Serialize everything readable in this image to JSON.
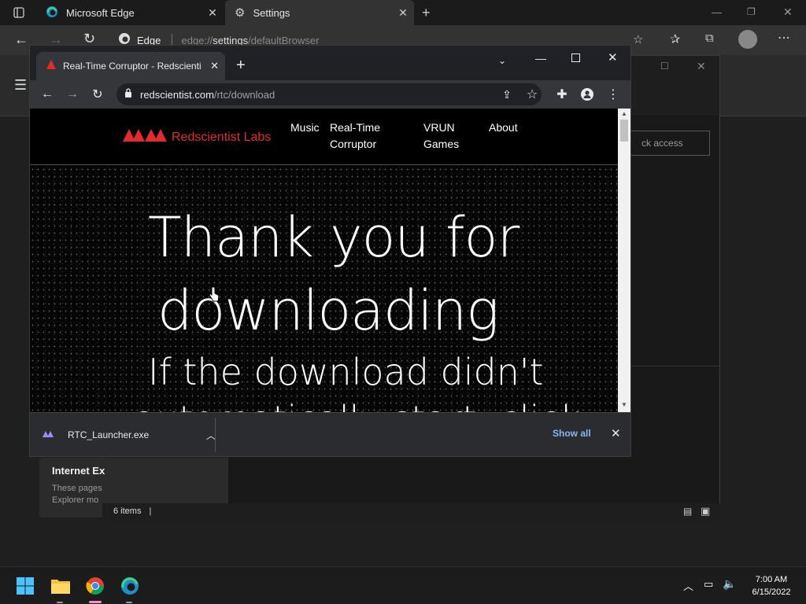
{
  "edge": {
    "tabs": [
      {
        "label": "Microsoft Edge"
      },
      {
        "label": "Settings"
      }
    ],
    "address": {
      "brand": "Edge",
      "url_prefix": "edge://",
      "url_strong": "settings",
      "url_rest": "/defaultBrowser"
    },
    "quick_access_placeholder": "ck access"
  },
  "explorer": {
    "ie_card_title": "Internet Ex",
    "ie_card_desc_line1": "These pages",
    "ie_card_desc_line2": "Explorer mo",
    "status_items": "6 items"
  },
  "chrome": {
    "tab_title": "Real-Time Corruptor - Redscienti",
    "url_host": "redscientist.com",
    "url_path": "/rtc/download",
    "site": {
      "logo_text": "Redscientist Labs",
      "nav": [
        {
          "line1": "Music",
          "line2": ""
        },
        {
          "line1": "Real-Time",
          "line2": "Corruptor"
        },
        {
          "line1": "VRUN",
          "line2": "Games"
        },
        {
          "line1": "About",
          "line2": ""
        }
      ],
      "hero_line1": "Thank you for",
      "hero_line2": "downloading",
      "hero_sub": "If the download didn't",
      "hero_sub_cut": "automatically start, click"
    },
    "download": {
      "filename": "RTC_Launcher.exe",
      "show_all": "Show all"
    }
  },
  "taskbar": {
    "time": "7:00 AM",
    "date": "6/15/2022"
  },
  "colors": {
    "accent_red": "#e32b2b",
    "link_blue": "#8ab4f8"
  }
}
